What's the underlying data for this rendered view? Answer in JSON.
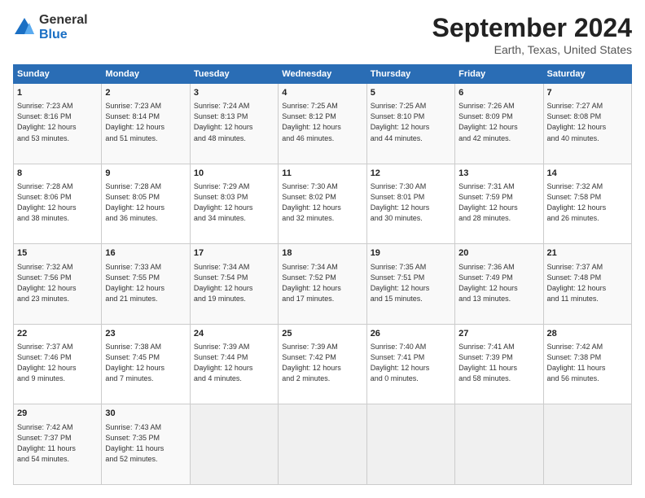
{
  "logo": {
    "general": "General",
    "blue": "Blue"
  },
  "title": {
    "month_year": "September 2024",
    "location": "Earth, Texas, United States"
  },
  "weekdays": [
    "Sunday",
    "Monday",
    "Tuesday",
    "Wednesday",
    "Thursday",
    "Friday",
    "Saturday"
  ],
  "weeks": [
    [
      {
        "day": "1",
        "info": "Sunrise: 7:23 AM\nSunset: 8:16 PM\nDaylight: 12 hours\nand 53 minutes."
      },
      {
        "day": "2",
        "info": "Sunrise: 7:23 AM\nSunset: 8:14 PM\nDaylight: 12 hours\nand 51 minutes."
      },
      {
        "day": "3",
        "info": "Sunrise: 7:24 AM\nSunset: 8:13 PM\nDaylight: 12 hours\nand 48 minutes."
      },
      {
        "day": "4",
        "info": "Sunrise: 7:25 AM\nSunset: 8:12 PM\nDaylight: 12 hours\nand 46 minutes."
      },
      {
        "day": "5",
        "info": "Sunrise: 7:25 AM\nSunset: 8:10 PM\nDaylight: 12 hours\nand 44 minutes."
      },
      {
        "day": "6",
        "info": "Sunrise: 7:26 AM\nSunset: 8:09 PM\nDaylight: 12 hours\nand 42 minutes."
      },
      {
        "day": "7",
        "info": "Sunrise: 7:27 AM\nSunset: 8:08 PM\nDaylight: 12 hours\nand 40 minutes."
      }
    ],
    [
      {
        "day": "8",
        "info": "Sunrise: 7:28 AM\nSunset: 8:06 PM\nDaylight: 12 hours\nand 38 minutes."
      },
      {
        "day": "9",
        "info": "Sunrise: 7:28 AM\nSunset: 8:05 PM\nDaylight: 12 hours\nand 36 minutes."
      },
      {
        "day": "10",
        "info": "Sunrise: 7:29 AM\nSunset: 8:03 PM\nDaylight: 12 hours\nand 34 minutes."
      },
      {
        "day": "11",
        "info": "Sunrise: 7:30 AM\nSunset: 8:02 PM\nDaylight: 12 hours\nand 32 minutes."
      },
      {
        "day": "12",
        "info": "Sunrise: 7:30 AM\nSunset: 8:01 PM\nDaylight: 12 hours\nand 30 minutes."
      },
      {
        "day": "13",
        "info": "Sunrise: 7:31 AM\nSunset: 7:59 PM\nDaylight: 12 hours\nand 28 minutes."
      },
      {
        "day": "14",
        "info": "Sunrise: 7:32 AM\nSunset: 7:58 PM\nDaylight: 12 hours\nand 26 minutes."
      }
    ],
    [
      {
        "day": "15",
        "info": "Sunrise: 7:32 AM\nSunset: 7:56 PM\nDaylight: 12 hours\nand 23 minutes."
      },
      {
        "day": "16",
        "info": "Sunrise: 7:33 AM\nSunset: 7:55 PM\nDaylight: 12 hours\nand 21 minutes."
      },
      {
        "day": "17",
        "info": "Sunrise: 7:34 AM\nSunset: 7:54 PM\nDaylight: 12 hours\nand 19 minutes."
      },
      {
        "day": "18",
        "info": "Sunrise: 7:34 AM\nSunset: 7:52 PM\nDaylight: 12 hours\nand 17 minutes."
      },
      {
        "day": "19",
        "info": "Sunrise: 7:35 AM\nSunset: 7:51 PM\nDaylight: 12 hours\nand 15 minutes."
      },
      {
        "day": "20",
        "info": "Sunrise: 7:36 AM\nSunset: 7:49 PM\nDaylight: 12 hours\nand 13 minutes."
      },
      {
        "day": "21",
        "info": "Sunrise: 7:37 AM\nSunset: 7:48 PM\nDaylight: 12 hours\nand 11 minutes."
      }
    ],
    [
      {
        "day": "22",
        "info": "Sunrise: 7:37 AM\nSunset: 7:46 PM\nDaylight: 12 hours\nand 9 minutes."
      },
      {
        "day": "23",
        "info": "Sunrise: 7:38 AM\nSunset: 7:45 PM\nDaylight: 12 hours\nand 7 minutes."
      },
      {
        "day": "24",
        "info": "Sunrise: 7:39 AM\nSunset: 7:44 PM\nDaylight: 12 hours\nand 4 minutes."
      },
      {
        "day": "25",
        "info": "Sunrise: 7:39 AM\nSunset: 7:42 PM\nDaylight: 12 hours\nand 2 minutes."
      },
      {
        "day": "26",
        "info": "Sunrise: 7:40 AM\nSunset: 7:41 PM\nDaylight: 12 hours\nand 0 minutes."
      },
      {
        "day": "27",
        "info": "Sunrise: 7:41 AM\nSunset: 7:39 PM\nDaylight: 11 hours\nand 58 minutes."
      },
      {
        "day": "28",
        "info": "Sunrise: 7:42 AM\nSunset: 7:38 PM\nDaylight: 11 hours\nand 56 minutes."
      }
    ],
    [
      {
        "day": "29",
        "info": "Sunrise: 7:42 AM\nSunset: 7:37 PM\nDaylight: 11 hours\nand 54 minutes."
      },
      {
        "day": "30",
        "info": "Sunrise: 7:43 AM\nSunset: 7:35 PM\nDaylight: 11 hours\nand 52 minutes."
      },
      {
        "day": "",
        "info": ""
      },
      {
        "day": "",
        "info": ""
      },
      {
        "day": "",
        "info": ""
      },
      {
        "day": "",
        "info": ""
      },
      {
        "day": "",
        "info": ""
      }
    ]
  ]
}
